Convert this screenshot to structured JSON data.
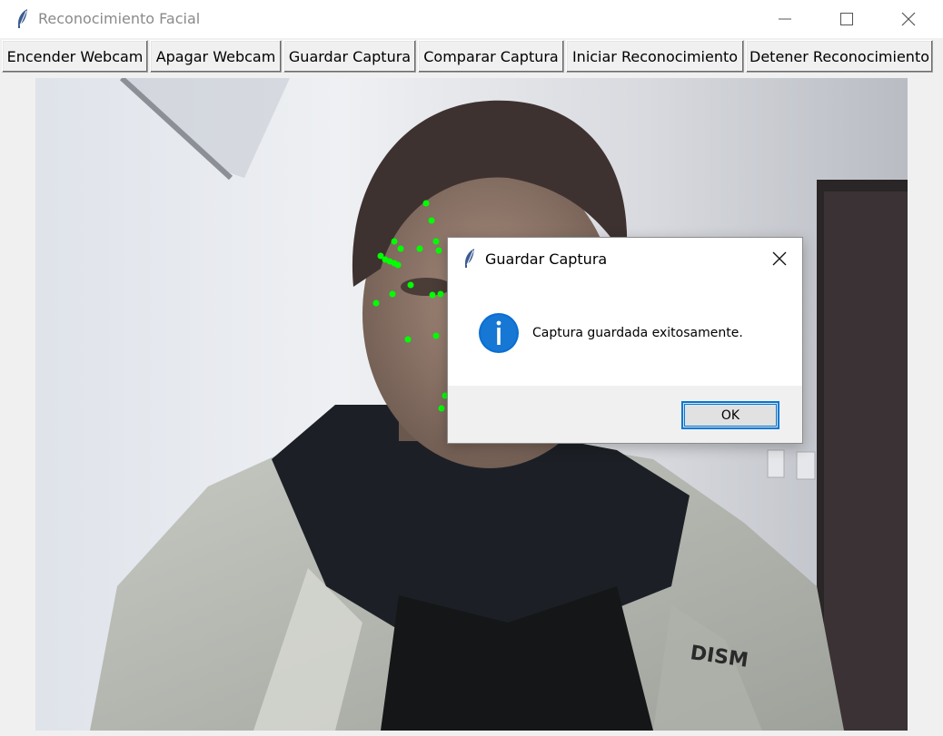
{
  "window": {
    "title": "Reconocimiento Facial"
  },
  "toolbar": {
    "buttons": [
      {
        "label": "Encender Webcam"
      },
      {
        "label": "Apagar Webcam"
      },
      {
        "label": "Guardar Captura"
      },
      {
        "label": "Comparar Captura"
      },
      {
        "label": "Iniciar Reconocimiento"
      },
      {
        "label": "Detener Reconocimiento"
      }
    ]
  },
  "dialog": {
    "title": "Guardar Captura",
    "message": "Captura guardada exitosamente.",
    "ok_label": "OK"
  },
  "colors": {
    "landmark": "#00ff00",
    "accent": "#0078d7",
    "info_icon": "#0a6ed1"
  },
  "icons": {
    "app": "feather-icon",
    "info": "info-icon",
    "close": "close-icon",
    "minimize": "minimize-icon",
    "maximize": "maximize-icon"
  },
  "text_in_image": "DISM"
}
